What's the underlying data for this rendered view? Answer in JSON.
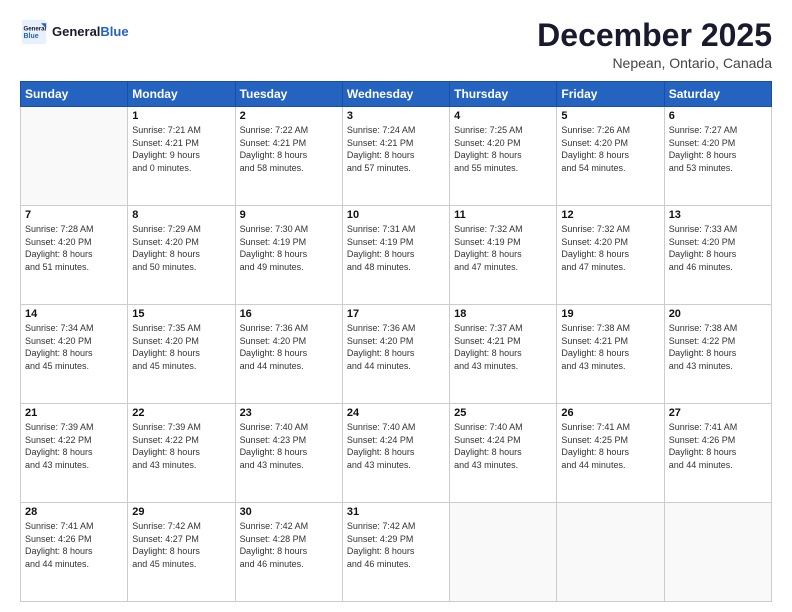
{
  "header": {
    "logo_general": "General",
    "logo_blue": "Blue",
    "month": "December 2025",
    "location": "Nepean, Ontario, Canada"
  },
  "days_of_week": [
    "Sunday",
    "Monday",
    "Tuesday",
    "Wednesday",
    "Thursday",
    "Friday",
    "Saturday"
  ],
  "weeks": [
    [
      {
        "day": "",
        "info": ""
      },
      {
        "day": "1",
        "info": "Sunrise: 7:21 AM\nSunset: 4:21 PM\nDaylight: 9 hours\nand 0 minutes."
      },
      {
        "day": "2",
        "info": "Sunrise: 7:22 AM\nSunset: 4:21 PM\nDaylight: 8 hours\nand 58 minutes."
      },
      {
        "day": "3",
        "info": "Sunrise: 7:24 AM\nSunset: 4:21 PM\nDaylight: 8 hours\nand 57 minutes."
      },
      {
        "day": "4",
        "info": "Sunrise: 7:25 AM\nSunset: 4:20 PM\nDaylight: 8 hours\nand 55 minutes."
      },
      {
        "day": "5",
        "info": "Sunrise: 7:26 AM\nSunset: 4:20 PM\nDaylight: 8 hours\nand 54 minutes."
      },
      {
        "day": "6",
        "info": "Sunrise: 7:27 AM\nSunset: 4:20 PM\nDaylight: 8 hours\nand 53 minutes."
      }
    ],
    [
      {
        "day": "7",
        "info": "Sunrise: 7:28 AM\nSunset: 4:20 PM\nDaylight: 8 hours\nand 51 minutes."
      },
      {
        "day": "8",
        "info": "Sunrise: 7:29 AM\nSunset: 4:20 PM\nDaylight: 8 hours\nand 50 minutes."
      },
      {
        "day": "9",
        "info": "Sunrise: 7:30 AM\nSunset: 4:19 PM\nDaylight: 8 hours\nand 49 minutes."
      },
      {
        "day": "10",
        "info": "Sunrise: 7:31 AM\nSunset: 4:19 PM\nDaylight: 8 hours\nand 48 minutes."
      },
      {
        "day": "11",
        "info": "Sunrise: 7:32 AM\nSunset: 4:19 PM\nDaylight: 8 hours\nand 47 minutes."
      },
      {
        "day": "12",
        "info": "Sunrise: 7:32 AM\nSunset: 4:20 PM\nDaylight: 8 hours\nand 47 minutes."
      },
      {
        "day": "13",
        "info": "Sunrise: 7:33 AM\nSunset: 4:20 PM\nDaylight: 8 hours\nand 46 minutes."
      }
    ],
    [
      {
        "day": "14",
        "info": "Sunrise: 7:34 AM\nSunset: 4:20 PM\nDaylight: 8 hours\nand 45 minutes."
      },
      {
        "day": "15",
        "info": "Sunrise: 7:35 AM\nSunset: 4:20 PM\nDaylight: 8 hours\nand 45 minutes."
      },
      {
        "day": "16",
        "info": "Sunrise: 7:36 AM\nSunset: 4:20 PM\nDaylight: 8 hours\nand 44 minutes."
      },
      {
        "day": "17",
        "info": "Sunrise: 7:36 AM\nSunset: 4:20 PM\nDaylight: 8 hours\nand 44 minutes."
      },
      {
        "day": "18",
        "info": "Sunrise: 7:37 AM\nSunset: 4:21 PM\nDaylight: 8 hours\nand 43 minutes."
      },
      {
        "day": "19",
        "info": "Sunrise: 7:38 AM\nSunset: 4:21 PM\nDaylight: 8 hours\nand 43 minutes."
      },
      {
        "day": "20",
        "info": "Sunrise: 7:38 AM\nSunset: 4:22 PM\nDaylight: 8 hours\nand 43 minutes."
      }
    ],
    [
      {
        "day": "21",
        "info": "Sunrise: 7:39 AM\nSunset: 4:22 PM\nDaylight: 8 hours\nand 43 minutes."
      },
      {
        "day": "22",
        "info": "Sunrise: 7:39 AM\nSunset: 4:22 PM\nDaylight: 8 hours\nand 43 minutes."
      },
      {
        "day": "23",
        "info": "Sunrise: 7:40 AM\nSunset: 4:23 PM\nDaylight: 8 hours\nand 43 minutes."
      },
      {
        "day": "24",
        "info": "Sunrise: 7:40 AM\nSunset: 4:24 PM\nDaylight: 8 hours\nand 43 minutes."
      },
      {
        "day": "25",
        "info": "Sunrise: 7:40 AM\nSunset: 4:24 PM\nDaylight: 8 hours\nand 43 minutes."
      },
      {
        "day": "26",
        "info": "Sunrise: 7:41 AM\nSunset: 4:25 PM\nDaylight: 8 hours\nand 44 minutes."
      },
      {
        "day": "27",
        "info": "Sunrise: 7:41 AM\nSunset: 4:26 PM\nDaylight: 8 hours\nand 44 minutes."
      }
    ],
    [
      {
        "day": "28",
        "info": "Sunrise: 7:41 AM\nSunset: 4:26 PM\nDaylight: 8 hours\nand 44 minutes."
      },
      {
        "day": "29",
        "info": "Sunrise: 7:42 AM\nSunset: 4:27 PM\nDaylight: 8 hours\nand 45 minutes."
      },
      {
        "day": "30",
        "info": "Sunrise: 7:42 AM\nSunset: 4:28 PM\nDaylight: 8 hours\nand 46 minutes."
      },
      {
        "day": "31",
        "info": "Sunrise: 7:42 AM\nSunset: 4:29 PM\nDaylight: 8 hours\nand 46 minutes."
      },
      {
        "day": "",
        "info": ""
      },
      {
        "day": "",
        "info": ""
      },
      {
        "day": "",
        "info": ""
      }
    ]
  ]
}
